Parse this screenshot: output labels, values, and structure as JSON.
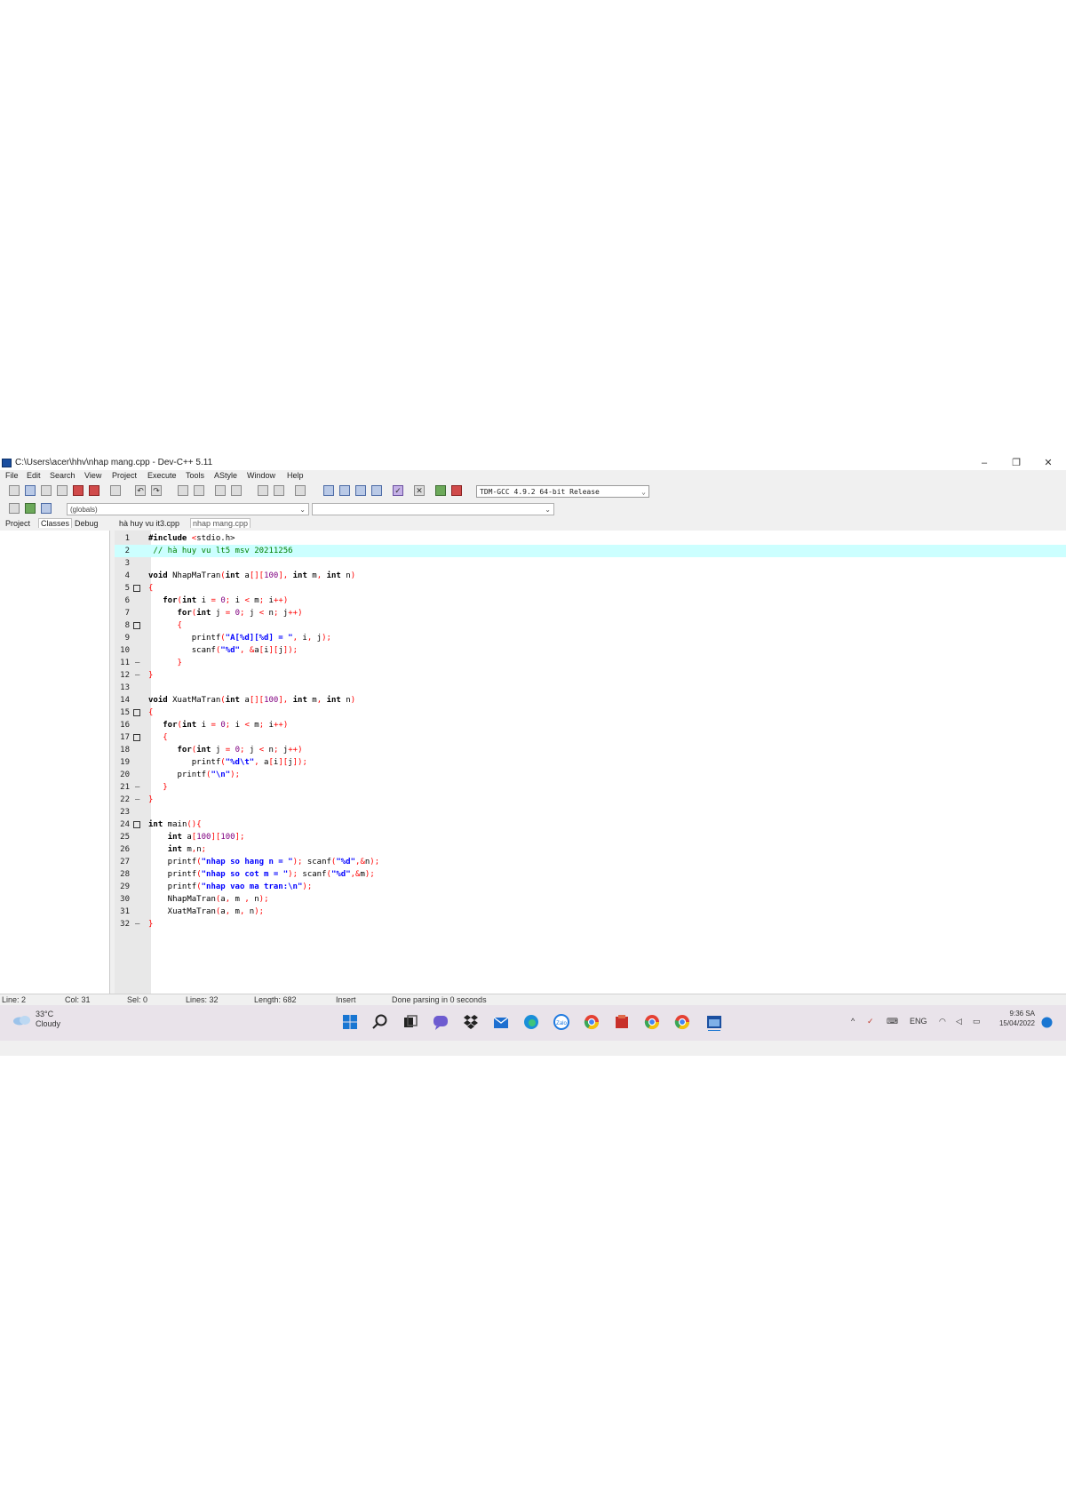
{
  "window": {
    "title": "C:\\Users\\acer\\hhv\\nhap mang.cpp - Dev-C++ 5.11",
    "minimize": "–",
    "maximize": "❐",
    "close": "✕"
  },
  "menu": [
    "File",
    "Edit",
    "Search",
    "View",
    "Project",
    "Execute",
    "Tools",
    "AStyle",
    "Window",
    "Help"
  ],
  "toolbar": {
    "compiler": "TDM-GCC 4.9.2 64-bit Release",
    "globals": "(globals)"
  },
  "left_tabs": [
    "Project",
    "Classes",
    "Debug"
  ],
  "file_tabs": [
    "hà huy vu it3.cpp",
    "nhap mang.cpp"
  ],
  "editor": {
    "current_line": 2,
    "lines": [
      {
        "n": "1",
        "fold": "",
        "code": "#include <stdio.h>"
      },
      {
        "n": "2",
        "fold": "",
        "code": " // hà huy vu lt5 msv 20211256"
      },
      {
        "n": "3",
        "fold": "",
        "code": ""
      },
      {
        "n": "4",
        "fold": "",
        "code": "void NhapMaTran(int a[][100], int m, int n)"
      },
      {
        "n": "5",
        "fold": "box",
        "code": "{"
      },
      {
        "n": "6",
        "fold": "",
        "code": "   for(int i = 0; i < m; i++)"
      },
      {
        "n": "7",
        "fold": "",
        "code": "      for(int j = 0; j < n; j++)"
      },
      {
        "n": "8",
        "fold": "box",
        "code": "      {"
      },
      {
        "n": "9",
        "fold": "",
        "code": "         printf(\"A[%d][%d] = \", i, j);"
      },
      {
        "n": "10",
        "fold": "",
        "code": "         scanf(\"%d\", &a[i][j]);"
      },
      {
        "n": "11",
        "fold": "-",
        "code": "      }"
      },
      {
        "n": "12",
        "fold": "-",
        "code": "}"
      },
      {
        "n": "13",
        "fold": "",
        "code": ""
      },
      {
        "n": "14",
        "fold": "",
        "code": "void XuatMaTran(int a[][100], int m, int n)"
      },
      {
        "n": "15",
        "fold": "box",
        "code": "{"
      },
      {
        "n": "16",
        "fold": "",
        "code": "   for(int i = 0; i < m; i++)"
      },
      {
        "n": "17",
        "fold": "box",
        "code": "   {"
      },
      {
        "n": "18",
        "fold": "",
        "code": "      for(int j = 0; j < n; j++)"
      },
      {
        "n": "19",
        "fold": "",
        "code": "         printf(\"%d\\t\", a[i][j]);"
      },
      {
        "n": "20",
        "fold": "",
        "code": "      printf(\"\\n\");"
      },
      {
        "n": "21",
        "fold": "-",
        "code": "   }"
      },
      {
        "n": "22",
        "fold": "-",
        "code": "}"
      },
      {
        "n": "23",
        "fold": "",
        "code": ""
      },
      {
        "n": "24",
        "fold": "box",
        "code": "int main(){"
      },
      {
        "n": "25",
        "fold": "",
        "code": "    int a[100][100];"
      },
      {
        "n": "26",
        "fold": "",
        "code": "    int m,n;"
      },
      {
        "n": "27",
        "fold": "",
        "code": "    printf(\"nhap so hang n = \"); scanf(\"%d\",&n);"
      },
      {
        "n": "28",
        "fold": "",
        "code": "    printf(\"nhap so cot m = \"); scanf(\"%d\",&m);"
      },
      {
        "n": "29",
        "fold": "",
        "code": "    printf(\"nhap vao ma tran:\\n\");"
      },
      {
        "n": "30",
        "fold": "",
        "code": "    NhapMaTran(a, m , n);"
      },
      {
        "n": "31",
        "fold": "",
        "code": "    XuatMaTran(a, m, n);"
      },
      {
        "n": "32",
        "fold": "-",
        "code": "}"
      }
    ]
  },
  "status": {
    "line": "Line: 2",
    "col": "Col: 31",
    "sel": "Sel: 0",
    "lines": "Lines: 32",
    "length": "Length: 682",
    "mode": "Insert",
    "message": "Done parsing in 0 seconds"
  },
  "taskbar": {
    "weather_temp": "33°C",
    "weather_desc": "Cloudy",
    "lang": "ENG",
    "time": "9:36 SA",
    "date": "15/04/2022"
  },
  "colors": {
    "current_line": "#ccffff",
    "keyword": "#000080",
    "string": "#0000ff",
    "number": "#800080",
    "comment": "#008000",
    "operator": "#ff0000"
  }
}
